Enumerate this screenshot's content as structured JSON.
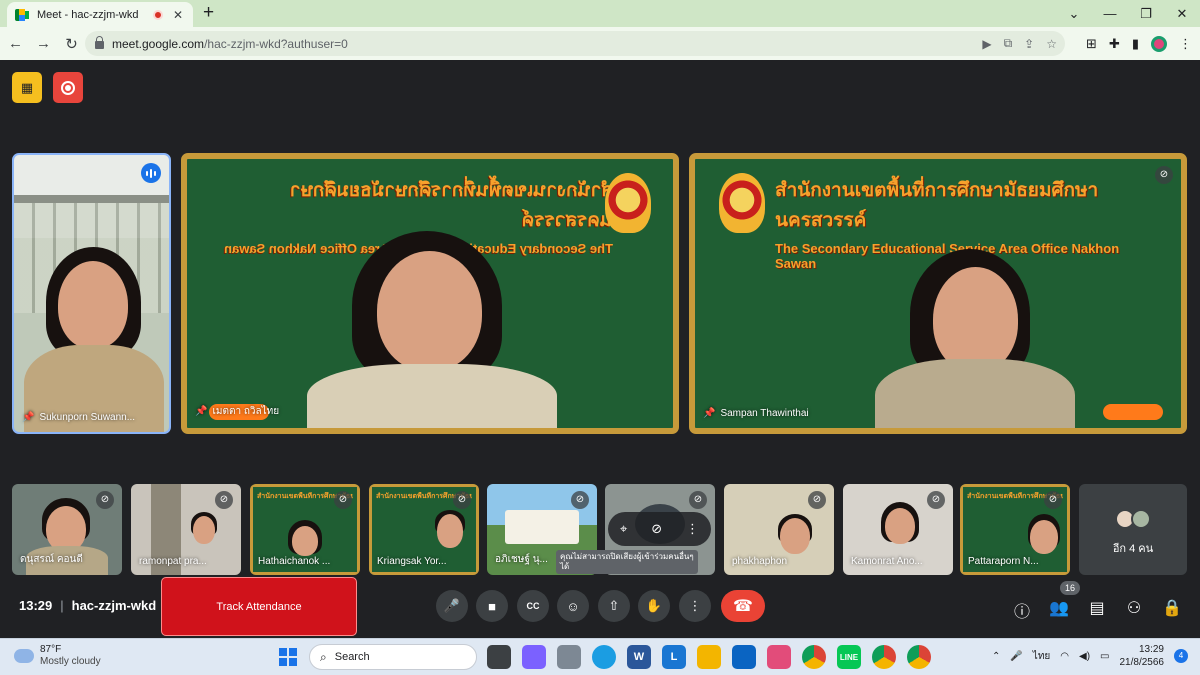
{
  "browser": {
    "tab_title": "Meet - hac-zzjm-wkd",
    "tab_close": "✕",
    "new_tab": "+",
    "window_controls": [
      "⌄",
      "—",
      "❐",
      "✕"
    ],
    "url_host": "meet.google.com",
    "url_path": "/hac-zzjm-wkd?authuser=0",
    "nav": [
      "←",
      "→",
      "↻"
    ],
    "omnibox_icons": [
      "▶",
      "⧉",
      "⇪",
      "☆"
    ],
    "extension_icons": [
      "⊞",
      "✚",
      "▮"
    ]
  },
  "meeting": {
    "host_controls": [
      "▦"
    ],
    "main_tiles": [
      {
        "name": "Sukunporn Suwann...",
        "status": "speaking"
      },
      {
        "name": "เมตตา ถวิลไทย",
        "board_th": "สำนักงานเขตพื้นที่การศึกษามัธยมศึกษานครสวรรค์",
        "board_en": "The Secondary Educational Service Area Office Nakhon Sawan"
      },
      {
        "name": "Sampan Thawinthai",
        "board_th": "สำนักงานเขตพื้นที่การศึกษามัธยมศึกษานครสวรรค์",
        "board_en": "The Secondary Educational Service Area Office Nakhon Sawan"
      }
    ],
    "thumbnails": [
      {
        "name": "ดนุสรณ์ คอนดี"
      },
      {
        "name": "ramonpat pra..."
      },
      {
        "name": "Hathaichanok ..."
      },
      {
        "name": "Kriangsak Yor..."
      },
      {
        "name": "อภิเชษฐ์ นุ..."
      },
      {
        "name": ""
      },
      {
        "name": "phakhaphon"
      },
      {
        "name": "Kamonrat Ano..."
      },
      {
        "name": "Pattaraporn N..."
      }
    ],
    "thumb_board_heading": "สำนักงานเขตพื้นที่การศึกษามัธยมศึกษานครสวรรค์",
    "more_label": "อีก 4 คน",
    "tooltip": "คุณไม่สามารถปิดเสียงผู้เข้าร่วมคนอื่นๆ ได้",
    "hover_controls": [
      "⌖",
      "⊘",
      "⋮"
    ],
    "time": "13:29",
    "meeting_code": "hac-zzjm-wkd",
    "separator": "|",
    "track_attendance": "Track Attendance",
    "controls": [
      "🎤",
      "■",
      "CC",
      "☺",
      "⇧",
      "✋",
      "⋮",
      "☎"
    ],
    "right_controls": [
      "ⓘ",
      "👥",
      "▤",
      "⚇",
      "🔒"
    ],
    "participant_count": "16"
  },
  "taskbar": {
    "temperature": "87°F",
    "weather": "Mostly cloudy",
    "search": "Search",
    "search_icon": "⌕",
    "tray_icons": [
      "⌃",
      "🎤"
    ],
    "language": "ไทย",
    "clock_time": "13:29",
    "clock_date": "21/8/2566",
    "notifications": "4"
  },
  "colors": {
    "tab_strip": "#cfe6c6",
    "meet_bg": "#202124",
    "board_green": "#1f5e33",
    "board_frame": "#c79a3a",
    "accent_red": "#ea4335",
    "track_button": "#d0121b"
  }
}
